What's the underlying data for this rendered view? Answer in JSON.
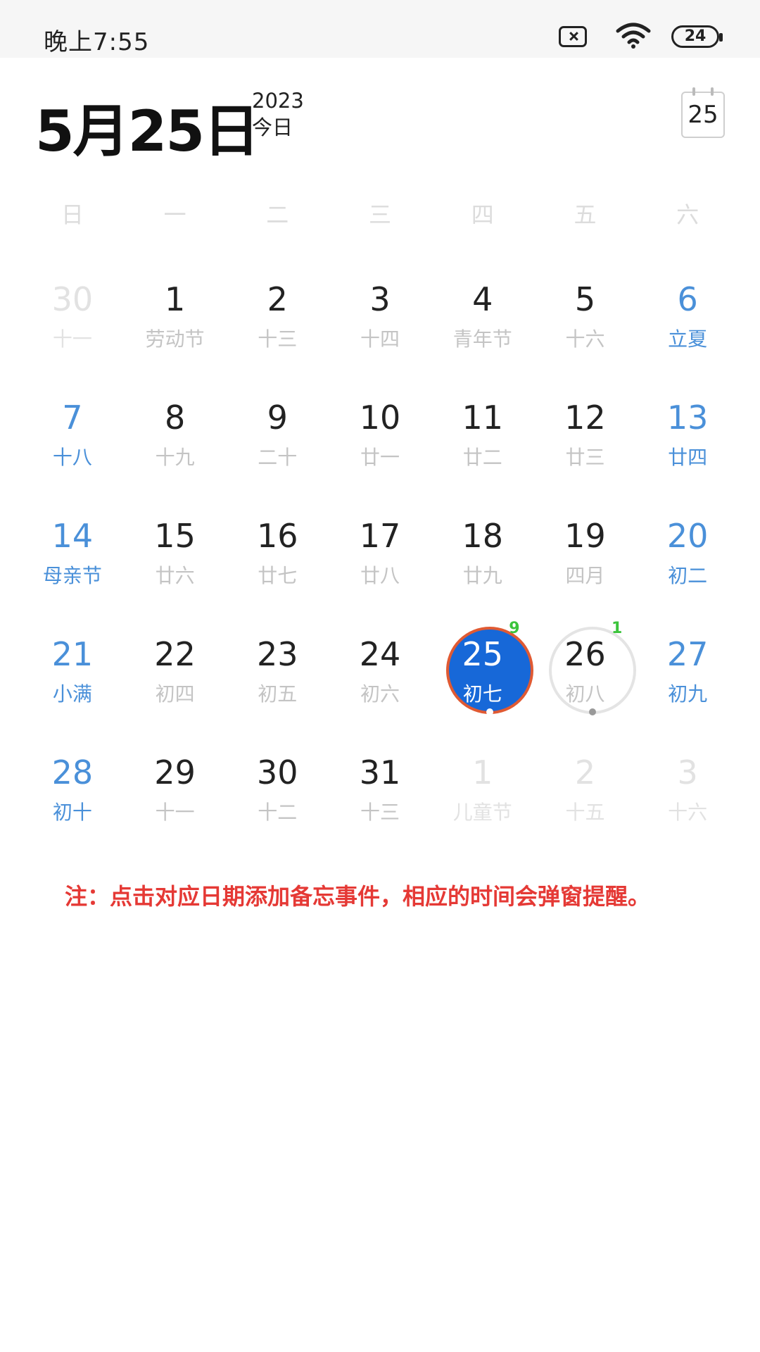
{
  "status_bar": {
    "time": "晚上7:55",
    "battery": "24"
  },
  "header": {
    "date": "5月25日",
    "year": "2023",
    "today_label": "今日",
    "today_button": "25"
  },
  "weekdays": [
    "日",
    "一",
    "二",
    "三",
    "四",
    "五",
    "六"
  ],
  "weeks": [
    [
      {
        "day": "30",
        "lunar": "十一",
        "type": "other"
      },
      {
        "day": "1",
        "lunar": "劳动节",
        "type": "normal"
      },
      {
        "day": "2",
        "lunar": "十三",
        "type": "normal"
      },
      {
        "day": "3",
        "lunar": "十四",
        "type": "normal"
      },
      {
        "day": "4",
        "lunar": "青年节",
        "type": "normal"
      },
      {
        "day": "5",
        "lunar": "十六",
        "type": "normal"
      },
      {
        "day": "6",
        "lunar": "立夏",
        "type": "weekend"
      }
    ],
    [
      {
        "day": "7",
        "lunar": "十八",
        "type": "weekend"
      },
      {
        "day": "8",
        "lunar": "十九",
        "type": "normal"
      },
      {
        "day": "9",
        "lunar": "二十",
        "type": "normal"
      },
      {
        "day": "10",
        "lunar": "廿一",
        "type": "normal"
      },
      {
        "day": "11",
        "lunar": "廿二",
        "type": "normal"
      },
      {
        "day": "12",
        "lunar": "廿三",
        "type": "normal"
      },
      {
        "day": "13",
        "lunar": "廿四",
        "type": "weekend"
      }
    ],
    [
      {
        "day": "14",
        "lunar": "母亲节",
        "type": "weekend"
      },
      {
        "day": "15",
        "lunar": "廿六",
        "type": "normal"
      },
      {
        "day": "16",
        "lunar": "廿七",
        "type": "normal"
      },
      {
        "day": "17",
        "lunar": "廿八",
        "type": "normal"
      },
      {
        "day": "18",
        "lunar": "廿九",
        "type": "normal"
      },
      {
        "day": "19",
        "lunar": "四月",
        "type": "normal"
      },
      {
        "day": "20",
        "lunar": "初二",
        "type": "weekend"
      }
    ],
    [
      {
        "day": "21",
        "lunar": "小满",
        "type": "weekend"
      },
      {
        "day": "22",
        "lunar": "初四",
        "type": "normal"
      },
      {
        "day": "23",
        "lunar": "初五",
        "type": "normal"
      },
      {
        "day": "24",
        "lunar": "初六",
        "type": "normal"
      },
      {
        "day": "25",
        "lunar": "初七",
        "type": "selected",
        "badge": "9"
      },
      {
        "day": "26",
        "lunar": "初八",
        "type": "outlined",
        "badge": "1"
      },
      {
        "day": "27",
        "lunar": "初九",
        "type": "weekend"
      }
    ],
    [
      {
        "day": "28",
        "lunar": "初十",
        "type": "weekend"
      },
      {
        "day": "29",
        "lunar": "十一",
        "type": "normal"
      },
      {
        "day": "30",
        "lunar": "十二",
        "type": "normal"
      },
      {
        "day": "31",
        "lunar": "十三",
        "type": "normal"
      },
      {
        "day": "1",
        "lunar": "儿童节",
        "type": "other"
      },
      {
        "day": "2",
        "lunar": "十五",
        "type": "other"
      },
      {
        "day": "3",
        "lunar": "十六",
        "type": "other"
      }
    ]
  ],
  "note": "注：点击对应日期添加备忘事件，相应的时间会弹窗提醒。",
  "colors": {
    "accent": "#1768d8",
    "weekend": "#4a90d9",
    "note": "#e53935",
    "badge": "#3cc43c"
  },
  "icons": [
    "sim-card-icon",
    "wifi-icon",
    "battery-icon",
    "calendar-today-icon"
  ]
}
